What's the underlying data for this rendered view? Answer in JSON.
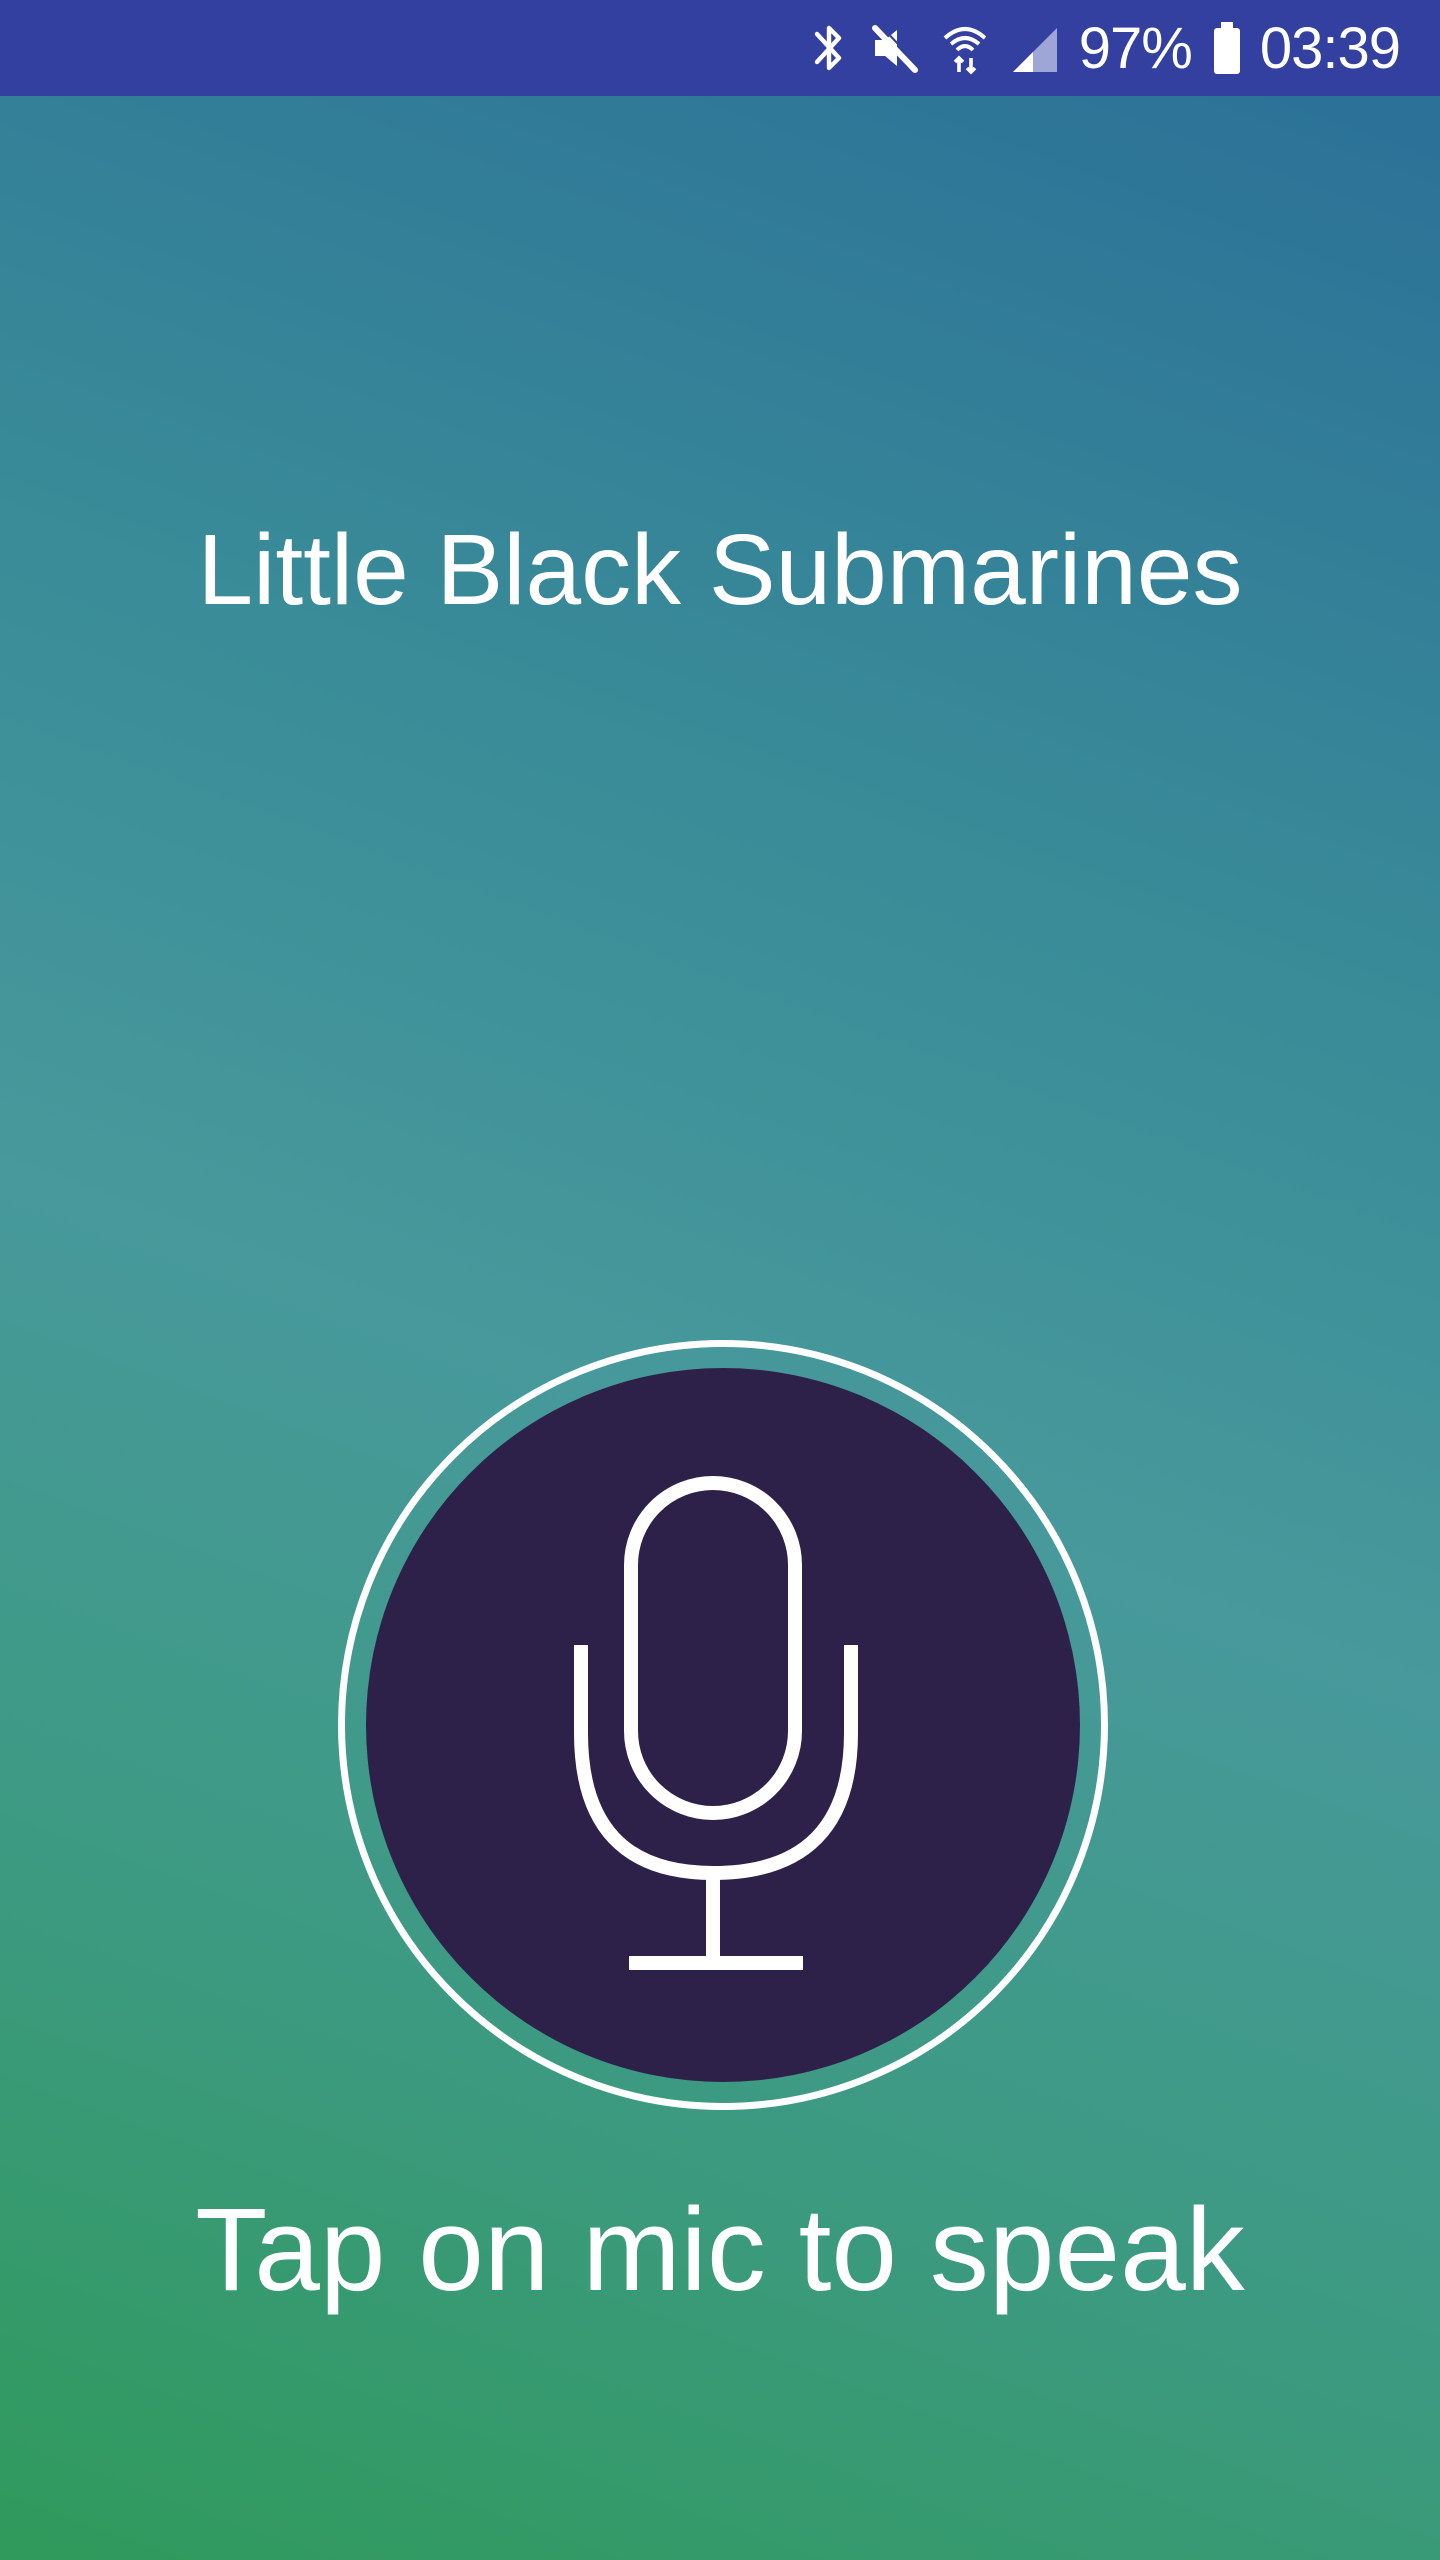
{
  "status_bar": {
    "battery_text": "97%",
    "time": "03:39",
    "icons": [
      "bluetooth-icon",
      "mute-icon",
      "wifi-icon",
      "signal-icon",
      "battery-icon"
    ]
  },
  "main": {
    "title": "Little Black Submarines",
    "hint": "Tap on mic to speak",
    "mic_icon": "microphone-icon"
  },
  "colors": {
    "status_bar": "#3340a0",
    "mic_fill": "#2e2149",
    "gradient_top": "#2a6e98",
    "gradient_bottom": "#2f9a5b",
    "text": "#ffffff"
  }
}
